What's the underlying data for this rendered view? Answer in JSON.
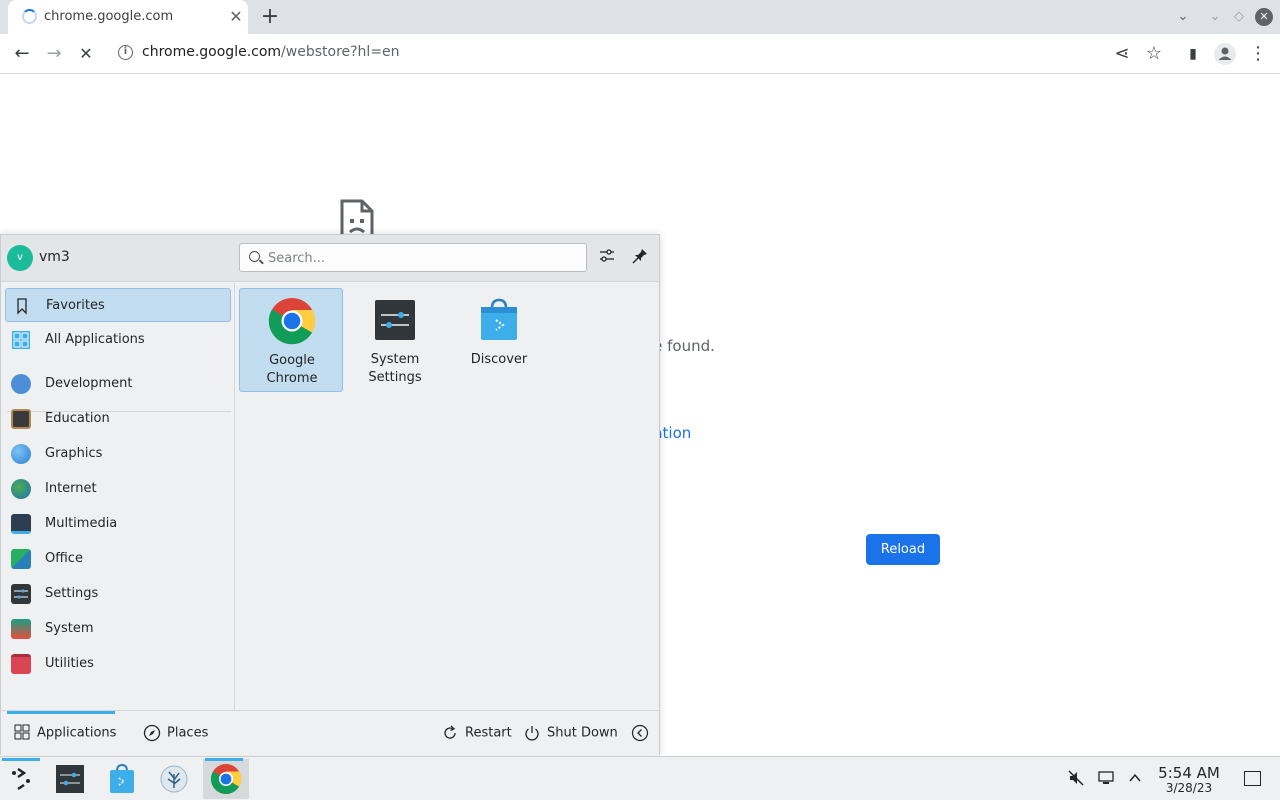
{
  "browser": {
    "tab": {
      "title": "chrome.google.com",
      "close_glyph": "✕"
    },
    "new_tab_glyph": "+",
    "window_controls": {
      "tablist_glyph": "⌄",
      "minimize_glyph": "⌄",
      "maximize_glyph": "◇",
      "close_glyph": "✕"
    },
    "url_host": "chrome.google.com",
    "url_rest": "/webstore?hl=en",
    "toolbar_glyphs": {
      "back": "←",
      "forward": "→",
      "stop": "✕",
      "info": "i",
      "share": "⋖",
      "bookmark": "☆",
      "side_panel": "▮",
      "menu": "⋮"
    }
  },
  "page": {
    "error_text": "d not be found.",
    "error_link": "onfiguration",
    "reload_label": "Reload"
  },
  "launcher": {
    "user": {
      "initial": "v",
      "name": "vm3"
    },
    "search_placeholder": "Search...",
    "categories": [
      {
        "label": "Favorites",
        "icon": "bookmark-icon",
        "active": true
      },
      {
        "label": "All Applications",
        "icon": "grid-icon"
      },
      {
        "label": "Development",
        "icon": "development-icon"
      },
      {
        "label": "Education",
        "icon": "education-icon"
      },
      {
        "label": "Graphics",
        "icon": "graphics-icon"
      },
      {
        "label": "Internet",
        "icon": "internet-icon"
      },
      {
        "label": "Multimedia",
        "icon": "multimedia-icon"
      },
      {
        "label": "Office",
        "icon": "office-icon"
      },
      {
        "label": "Settings",
        "icon": "settings-icon"
      },
      {
        "label": "System",
        "icon": "system-icon"
      },
      {
        "label": "Utilities",
        "icon": "utilities-icon"
      }
    ],
    "apps": [
      {
        "label": "Google\nChrome",
        "icon": "chrome-icon",
        "active": true
      },
      {
        "label": "System\nSettings",
        "icon": "system-settings-icon"
      },
      {
        "label": "Discover",
        "icon": "discover-icon"
      }
    ],
    "footer": {
      "applications_label": "Applications",
      "places_label": "Places",
      "restart_label": "Restart",
      "shutdown_label": "Shut Down"
    }
  },
  "taskbar": {
    "clock_time": "5:54 AM",
    "clock_date": "3/28/23"
  },
  "colors": {
    "accent": "#3daee9",
    "chrome_blue": "#1a73e8",
    "selection": "#c2dcf0"
  }
}
